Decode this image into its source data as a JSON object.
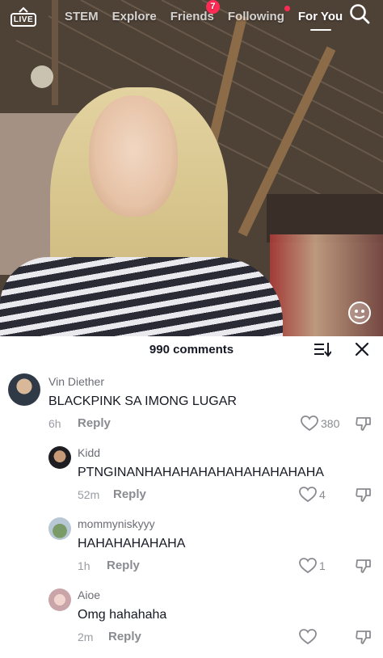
{
  "topbar": {
    "live_label": "LIVE",
    "tabs": [
      {
        "label": "STEM"
      },
      {
        "label": "Explore"
      },
      {
        "label": "Friends",
        "badge": "7"
      },
      {
        "label": "Following"
      },
      {
        "label": "For You"
      }
    ],
    "icons": {
      "search": "search-icon",
      "live": "live-tv-icon"
    }
  },
  "comments_panel": {
    "title": "990 comments",
    "icons": {
      "sort": "sort-icon",
      "close": "close-icon"
    },
    "comments": [
      {
        "user": "Vin Diether",
        "text": "BLACKPINK SA IMONG LUGAR",
        "time": "6h",
        "reply": "Reply",
        "likes": "380"
      },
      {
        "user": "Kidd",
        "text": "PTNGINANHAHAHAHAHAHAHAHAHAHA",
        "time": "52m",
        "reply": "Reply",
        "likes": "4"
      },
      {
        "user": "mommyniskyyy",
        "text": "HAHAHAHAHAHA",
        "time": "1h",
        "reply": "Reply",
        "likes": "1"
      },
      {
        "user": "Aioe",
        "text": "Omg hahahaha",
        "time": "2m",
        "reply": "Reply",
        "likes": ""
      }
    ]
  },
  "colors": {
    "accent": "#fe2c55",
    "text": "#161823",
    "muted": "#8a8b91"
  }
}
